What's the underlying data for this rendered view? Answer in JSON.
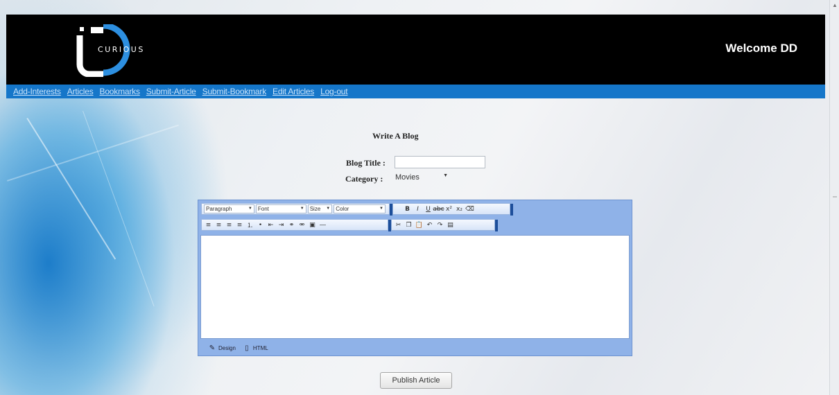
{
  "header": {
    "logo_text": "CURIOUS",
    "welcome": "Welcome DD"
  },
  "nav": {
    "items": [
      {
        "label": "Add-Interests"
      },
      {
        "label": "Articles"
      },
      {
        "label": "Bookmarks"
      },
      {
        "label": "Submit-Article"
      },
      {
        "label": "Submit-Bookmark"
      },
      {
        "label": "Edit Articles"
      },
      {
        "label": "Log-out"
      }
    ]
  },
  "form": {
    "title": "Write A Blog",
    "blog_title_label": "Blog Title :",
    "blog_title_value": "",
    "category_label": "Category :",
    "category_value": "Movies"
  },
  "editor": {
    "format_dropdowns": [
      "Paragraph",
      "Font",
      "Size",
      "Color"
    ],
    "mode_tabs": [
      "Design",
      "HTML"
    ]
  },
  "publish_button": "Publish Article",
  "colors": {
    "header_bg": "#000000",
    "nav_bg": "#1576c9",
    "logo_blue": "#2d8fe0",
    "editor_frame": "#8fb2e8"
  }
}
